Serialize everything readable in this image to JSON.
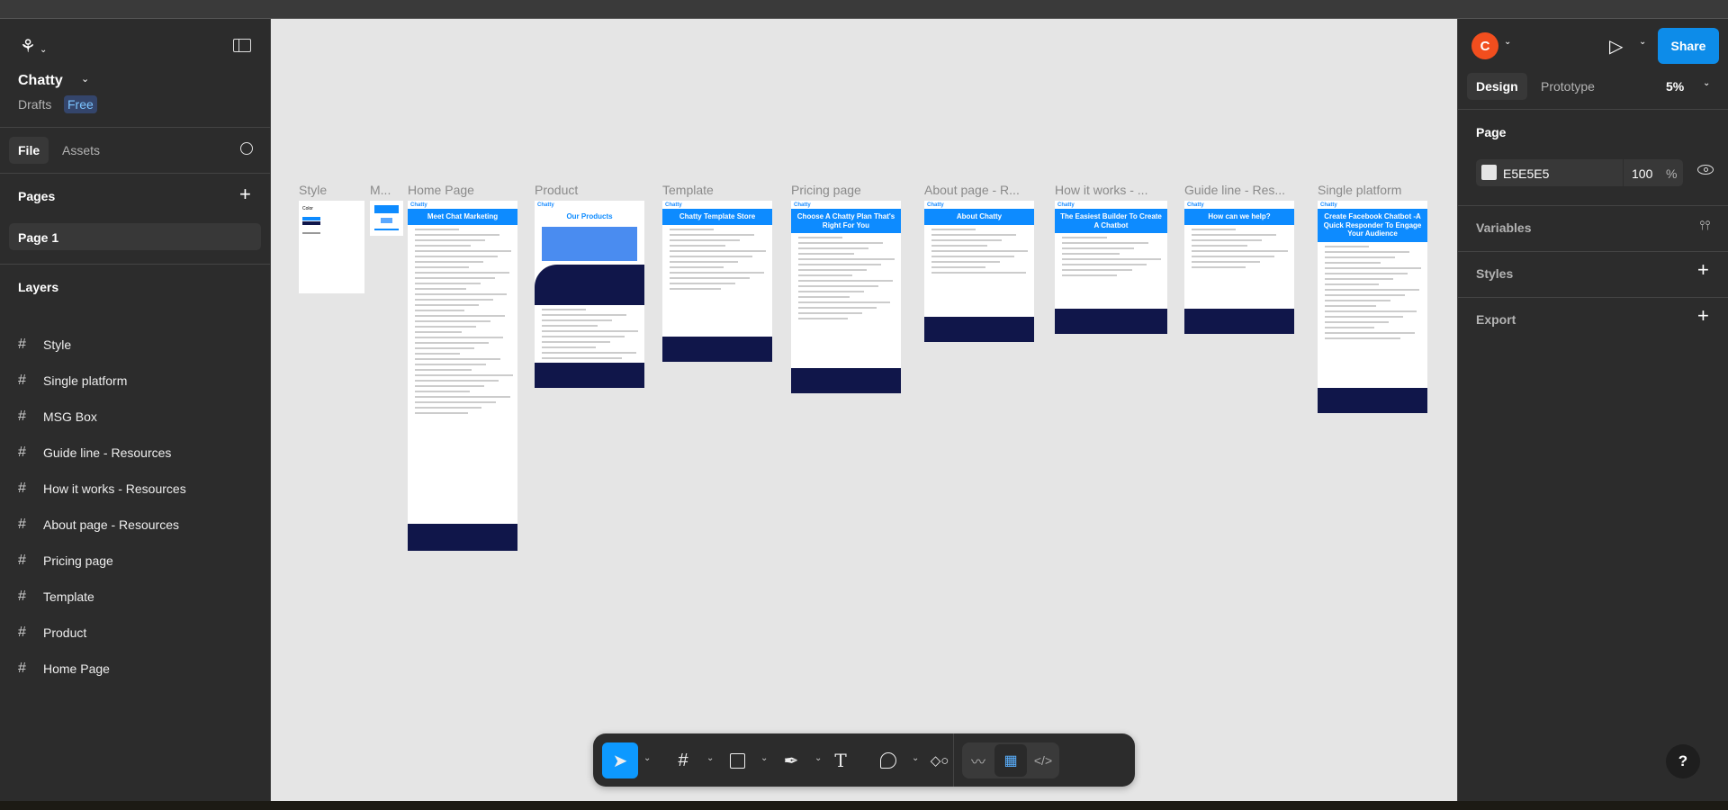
{
  "app": {
    "file_name": "Chatty",
    "location": "Drafts",
    "plan_badge": "Free"
  },
  "left_panel": {
    "tab_file": "File",
    "tab_assets": "Assets",
    "pages_heading": "Pages",
    "pages": [
      "Page 1"
    ],
    "layers_heading": "Layers",
    "layers": [
      "Style",
      "Single platform",
      "MSG Box",
      "Guide line - Resources",
      "How it works - Resources",
      "About page - Resources",
      "Pricing page",
      "Template",
      "Product",
      "Home Page"
    ]
  },
  "right_panel": {
    "avatar_initial": "C",
    "share_label": "Share",
    "tab_design": "Design",
    "tab_prototype": "Prototype",
    "zoom": "5%",
    "page_heading": "Page",
    "page_color": "E5E5E5",
    "page_opacity": "100",
    "percent": "%",
    "variables": "Variables",
    "styles": "Styles",
    "export": "Export"
  },
  "canvas": {
    "frames": [
      {
        "label": "Style",
        "title": "Color"
      },
      {
        "label": "M...",
        "title": ""
      },
      {
        "label": "Home Page",
        "title": "Meet Chat Marketing"
      },
      {
        "label": "Product",
        "title": "Our Products"
      },
      {
        "label": "Template",
        "title": "Chatty Template Store"
      },
      {
        "label": "Pricing page",
        "title": "Choose A Chatty Plan That's Right For You"
      },
      {
        "label": "About page - R...",
        "title": "About Chatty"
      },
      {
        "label": "How it works - ...",
        "title": "The Easiest Builder To Create A Chatbot"
      },
      {
        "label": "Guide line - Res...",
        "title": "How can we help?"
      },
      {
        "label": "Single platform",
        "title": "Create Facebook Chatbot -A Quick Responder To Engage Your Audience"
      }
    ],
    "brand": "Chatty"
  },
  "help": "?",
  "colors": {
    "accent": "#0d99ff",
    "canvas": "#E5E5E5",
    "panel": "#2c2c2c",
    "frame_blue": "#0d8bff",
    "footer_navy": "#10164a"
  }
}
